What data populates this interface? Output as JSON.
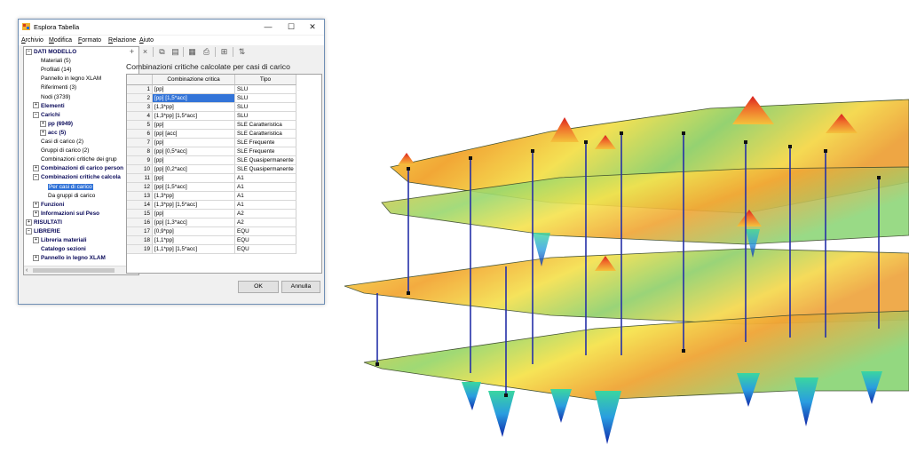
{
  "window": {
    "title": "Esplora Tabella",
    "minimize": "—",
    "maximize": "☐",
    "close": "✕"
  },
  "menu": [
    "Archivio",
    "Modifica",
    "Formato",
    "Relazione",
    "Aiuto"
  ],
  "tree": [
    {
      "label": "DATI MODELLO",
      "bold": true,
      "exp": "−",
      "indent": 0
    },
    {
      "label": "Materiali (5)",
      "indent": 1
    },
    {
      "label": "Profilati (14)",
      "indent": 1
    },
    {
      "label": "Pannello in legno XLAM",
      "indent": 1
    },
    {
      "label": "Riferimenti (3)",
      "indent": 1
    },
    {
      "label": "Nodi (3739)",
      "indent": 1
    },
    {
      "label": "Elementi",
      "bold": true,
      "exp": "+",
      "indent": 1
    },
    {
      "label": "Carichi",
      "bold": true,
      "exp": "−",
      "indent": 1
    },
    {
      "label": "pp (6949)",
      "bold": true,
      "exp": "+",
      "indent": 2
    },
    {
      "label": "acc (5)",
      "bold": true,
      "exp": "+",
      "indent": 2
    },
    {
      "label": "Casi di carico (2)",
      "indent": 1
    },
    {
      "label": "Gruppi di carico (2)",
      "indent": 1
    },
    {
      "label": "Combinazioni critiche dei grup",
      "indent": 1
    },
    {
      "label": "Combinazioni di carico person",
      "bold": true,
      "exp": "+",
      "indent": 1
    },
    {
      "label": "Combinazioni critiche calcola",
      "bold": true,
      "exp": "−",
      "indent": 1
    },
    {
      "label": "Per casi di carico",
      "indent": 2,
      "selected": true
    },
    {
      "label": "Da gruppi di carico",
      "indent": 2
    },
    {
      "label": "Funzioni",
      "bold": true,
      "exp": "+",
      "indent": 1
    },
    {
      "label": "Informazioni sul Peso",
      "bold": true,
      "exp": "+",
      "indent": 1
    },
    {
      "label": "RISULTATI",
      "bold": true,
      "exp": "+",
      "indent": 0
    },
    {
      "label": "LIBRERIE",
      "bold": true,
      "exp": "−",
      "indent": 0
    },
    {
      "label": "Libreria materiali",
      "bold": true,
      "exp": "+",
      "indent": 1
    },
    {
      "label": "Catalogo sezioni",
      "bold": true,
      "indent": 1
    },
    {
      "label": "Pannello in legno XLAM",
      "bold": true,
      "exp": "+",
      "indent": 1
    }
  ],
  "scroll": {
    "left": "‹",
    "right": "›"
  },
  "toolbar_icons": [
    "add-icon",
    "delete-icon",
    "copy-icon",
    "paste-icon",
    "columns-icon",
    "print-icon",
    "zoom-fit-icon",
    "export-icon"
  ],
  "table": {
    "title": "Combinazioni critiche calcolate per casi di carico",
    "headers": [
      "Combinazione critica",
      "Tipo"
    ],
    "rows": [
      [
        "1",
        "[pp]",
        "SLU"
      ],
      [
        "2",
        "[pp] [1,5*acc]",
        "SLU"
      ],
      [
        "3",
        "[1,3*pp]",
        "SLU"
      ],
      [
        "4",
        "[1,3*pp] [1,5*acc]",
        "SLU"
      ],
      [
        "5",
        "[pp]",
        "SLE Caratteristica"
      ],
      [
        "6",
        "[pp] [acc]",
        "SLE Caratteristica"
      ],
      [
        "7",
        "[pp]",
        "SLE Frequente"
      ],
      [
        "8",
        "[pp] [0,5*acc]",
        "SLE Frequente"
      ],
      [
        "9",
        "[pp]",
        "SLE Quasipermanente"
      ],
      [
        "10",
        "[pp] [0,2*acc]",
        "SLE Quasipermanente"
      ],
      [
        "11",
        "[pp]",
        "A1"
      ],
      [
        "12",
        "[pp] [1,5*acc]",
        "A1"
      ],
      [
        "13",
        "[1,3*pp]",
        "A1"
      ],
      [
        "14",
        "[1,3*pp] [1,5*acc]",
        "A1"
      ],
      [
        "15",
        "[pp]",
        "A2"
      ],
      [
        "16",
        "[pp] [1,3*acc]",
        "A2"
      ],
      [
        "17",
        "[0,9*pp]",
        "EQU"
      ],
      [
        "18",
        "[1,1*pp]",
        "EQU"
      ],
      [
        "19",
        "[1,1*pp] [1,5*acc]",
        "EQU"
      ]
    ],
    "selected_row": 1
  },
  "buttons": {
    "ok": "OK",
    "cancel": "Annulla"
  }
}
